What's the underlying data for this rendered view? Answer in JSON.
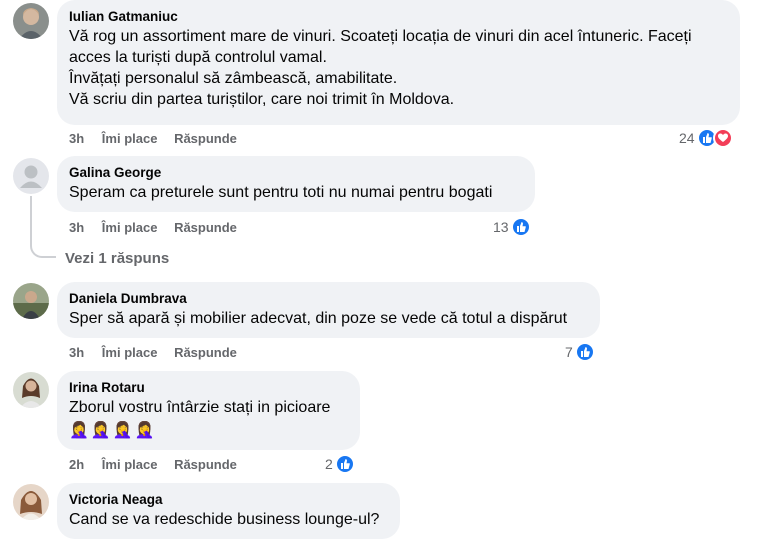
{
  "comments": [
    {
      "author": "Iulian Gatmaniuc",
      "text": "Vă rog un assortiment mare de vinuri. Scoateți locația de vinuri din acel întuneric. Faceți\nacces la turiști după controlul vamal.\nÎnvățați personalul să zâmbească, amabilitate.\nVă scriu din partea turiștilor, care noi trimit în Moldova.",
      "time": "3h",
      "like_label": "Îmi place",
      "reply_label": "Răspunde",
      "reaction_count": "24",
      "reactions": [
        "like-icon",
        "love-icon"
      ]
    },
    {
      "author": "Galina George",
      "text": "Speram ca preturele sunt pentru toti nu numai pentru bogati",
      "time": "3h",
      "like_label": "Îmi place",
      "reply_label": "Răspunde",
      "reaction_count": "13",
      "reactions": [
        "like-icon"
      ],
      "replies_link": "Vezi 1 răspuns"
    },
    {
      "author": "Daniela Dumbrava",
      "text": "Sper să apară și mobilier adecvat, din poze se vede că totul a dispărut",
      "time": "3h",
      "like_label": "Îmi place",
      "reply_label": "Răspunde",
      "reaction_count": "7",
      "reactions": [
        "like-icon"
      ]
    },
    {
      "author": "Irina Rotaru",
      "text": "Zborul vostru întârzie stați in picioare",
      "emojis": [
        "🤦‍♀️",
        "🤦‍♀️",
        "🤦‍♀️",
        "🤦‍♀️"
      ],
      "time": "2h",
      "like_label": "Îmi place",
      "reply_label": "Răspunde",
      "reaction_count": "2",
      "reactions": [
        "like-icon"
      ]
    },
    {
      "author": "Victoria Neaga",
      "text": "Cand se va redeschide business lounge-ul?"
    }
  ],
  "colors": {
    "bubble": "#f0f2f5",
    "meta": "#65676b",
    "like": "#1877f2",
    "love": "#f33e58"
  }
}
